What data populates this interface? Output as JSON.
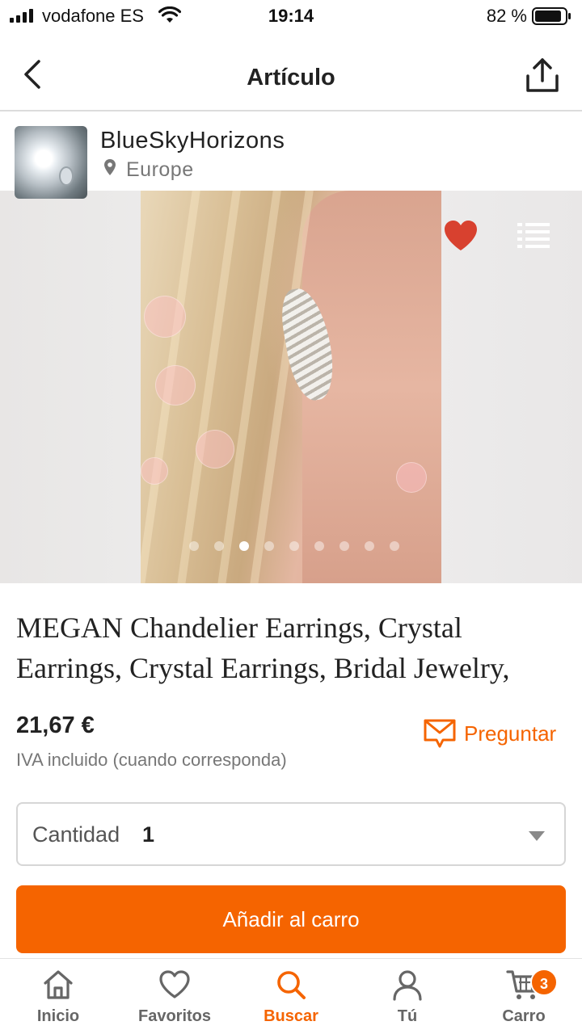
{
  "status_bar": {
    "carrier": "vodafone ES",
    "time": "19:14",
    "battery": "82 %",
    "icons": [
      "signal-icon",
      "wifi-icon",
      "battery-icon"
    ]
  },
  "nav": {
    "title": "Artículo",
    "icons": [
      "back-icon",
      "share-icon"
    ]
  },
  "shop": {
    "name": "BlueSkyHorizons",
    "location": "Europe",
    "icons": [
      "location-pin-icon"
    ]
  },
  "gallery": {
    "favorited": true,
    "image_count": 9,
    "active_index": 2,
    "icons": [
      "heart-icon",
      "list-icon"
    ],
    "colors": {
      "heart": "#d8412f"
    }
  },
  "product": {
    "title": "MEGAN Chandelier Earrings, Crystal Earrings, Crystal Earrings, Bridal Jewelry,",
    "price": "21,67 €",
    "vat_note": "IVA incluido (cuando corresponda)",
    "ask_label": "Preguntar",
    "quantity_label": "Cantidad",
    "quantity_value": "1",
    "add_to_cart_label": "Añadir al carro"
  },
  "tabs": [
    {
      "label": "Inicio",
      "icon": "home-icon",
      "active": false
    },
    {
      "label": "Favoritos",
      "icon": "heart-outline-icon",
      "active": false
    },
    {
      "label": "Buscar",
      "icon": "search-icon",
      "active": true
    },
    {
      "label": "Tú",
      "icon": "user-icon",
      "active": false
    },
    {
      "label": "Carro",
      "icon": "cart-icon",
      "active": false,
      "badge": "3"
    }
  ],
  "colors": {
    "accent": "#f56400",
    "text": "#222222",
    "muted": "#777777"
  }
}
